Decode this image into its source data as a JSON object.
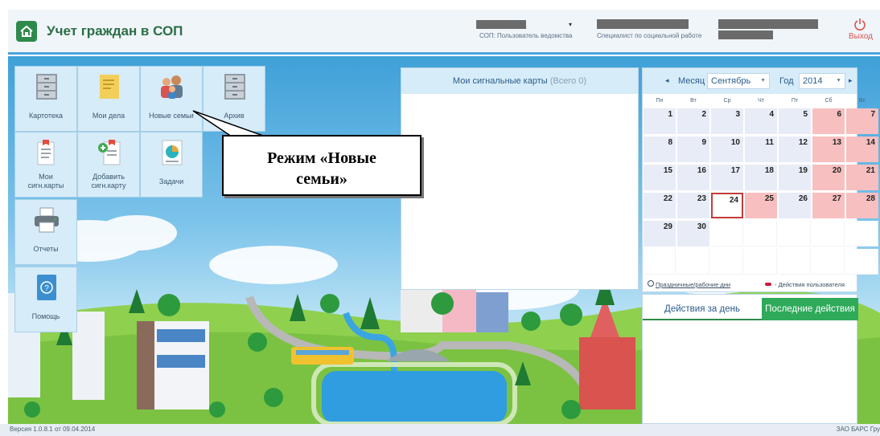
{
  "header": {
    "app_title": "Учет граждан в СОП",
    "role_text": "СОП: Пользователь ведомства",
    "position_text": "Специалист по социальной работе",
    "exit_label": "Выход"
  },
  "tiles": {
    "kartoteka": "Картотека",
    "my_cases": "Мои дела",
    "new_families": "Новые семьи",
    "archive": "Архив",
    "my_signal_cards": "Мои сигн.карты",
    "add_signal_card": "Добавить сигн.карту",
    "tasks": "Задачи",
    "reports": "Отчеты",
    "help": "Помощь"
  },
  "signals_panel": {
    "title": "Мои сигнальные карты",
    "count": "(Всего 0)"
  },
  "calendar": {
    "month_label": "Месяц",
    "month_value": "Сентябрь",
    "year_label": "Год",
    "year_value": "2014",
    "weekdays": [
      "Пн",
      "Вт",
      "Ср",
      "Чт",
      "Пт",
      "Сб",
      "Вс"
    ],
    "weeks": [
      [
        1,
        2,
        3,
        4,
        5,
        6,
        7
      ],
      [
        8,
        9,
        10,
        11,
        12,
        13,
        14
      ],
      [
        15,
        16,
        17,
        18,
        19,
        20,
        21
      ],
      [
        22,
        23,
        24,
        25,
        26,
        27,
        28
      ],
      [
        29,
        30,
        null,
        null,
        null,
        null,
        null
      ],
      [
        null,
        null,
        null,
        null,
        null,
        null,
        null
      ]
    ],
    "weekend_days": [
      6,
      7,
      13,
      14,
      20,
      21,
      25,
      27,
      28
    ],
    "today": 24,
    "legend_holidays": "Праздничные/рабочие дни",
    "legend_actions": "- Действия пользователя"
  },
  "actions_panel": {
    "tab_day": "Действия за день",
    "tab_recent": "Последние действия"
  },
  "callout": {
    "line1": "Режим «Новые",
    "line2": "семьи»"
  },
  "footer": {
    "version": "Версия 1.0.8.1 от 09.04.2014",
    "company": "ЗАО БАРС Гру"
  },
  "colors": {
    "accent_blue": "#4aa3df",
    "brand_green": "#2e8a4a",
    "tab_green": "#2eaa5a",
    "weekend_pink": "#f7bfbf",
    "today_border": "#c23b3b"
  },
  "icons": [
    "home-logo-icon",
    "power-icon",
    "file-cabinet-icon",
    "folder-icon",
    "family-icon",
    "archive-icon",
    "document-icon",
    "document-add-icon",
    "chart-icon",
    "printer-icon",
    "help-icon"
  ]
}
